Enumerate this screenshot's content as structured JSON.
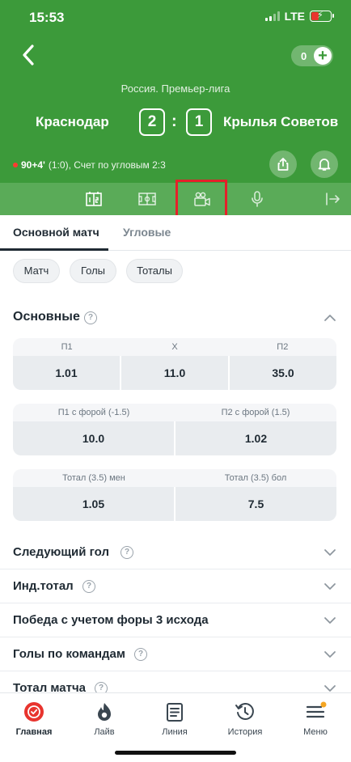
{
  "status_bar": {
    "time": "15:53",
    "network": "LTE"
  },
  "header": {
    "balance": "0",
    "league": "Россия. Премьер-лига",
    "home_team": "Краснодар",
    "away_team": "Крылья Советов",
    "home_score": "2",
    "away_score": "1",
    "score_separator": ":",
    "live_time": "90+4'",
    "live_details": "(1:0), Счет по угловым 2:3"
  },
  "market_tabs": {
    "main": "Основной матч",
    "corners": "Угловые"
  },
  "filters": [
    "Матч",
    "Голы",
    "Тоталы"
  ],
  "section": {
    "title": "Основные",
    "help": "?"
  },
  "odds_tables": [
    {
      "headers": [
        "П1",
        "X",
        "П2"
      ],
      "values": [
        "1.01",
        "11.0",
        "35.0"
      ]
    },
    {
      "headers": [
        "П1 с форой (-1.5)",
        "П2 с форой (1.5)"
      ],
      "values": [
        "10.0",
        "1.02"
      ]
    },
    {
      "headers": [
        "Тотал (3.5) мен",
        "Тотал (3.5) бол"
      ],
      "values": [
        "1.05",
        "7.5"
      ]
    }
  ],
  "markets": [
    "Следующий гол",
    "Инд.тотал",
    "Победа с учетом форы 3 исхода",
    "Голы по командам",
    "Тотал матча"
  ],
  "bottom_nav": [
    "Главная",
    "Лайв",
    "Линия",
    "История",
    "Меню"
  ],
  "colors": {
    "header_green": "#3c9a3a",
    "strip_green": "#5aab58",
    "highlight_red": "#e5202a"
  }
}
